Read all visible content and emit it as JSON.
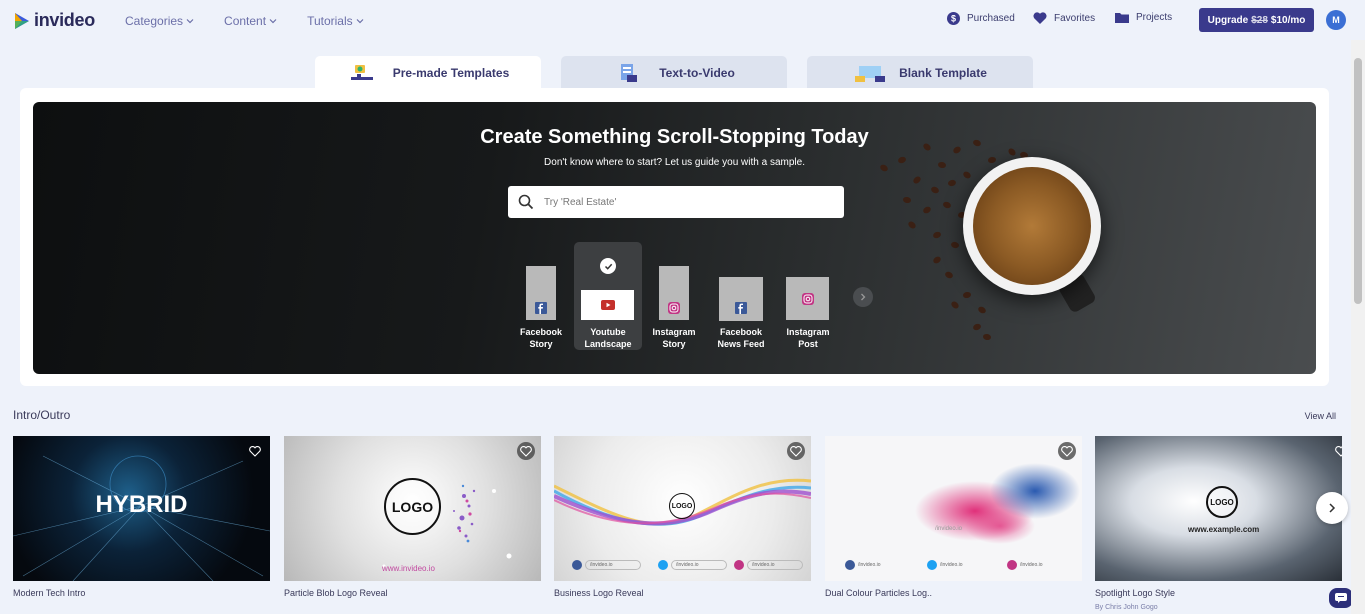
{
  "brand": {
    "name": "invideo"
  },
  "nav": {
    "menu": [
      {
        "label": "Categories"
      },
      {
        "label": "Content"
      },
      {
        "label": "Tutorials"
      }
    ],
    "purchased": "Purchased",
    "favorites": "Favorites",
    "projects": "Projects",
    "upgrade_prefix": "Upgrade",
    "upgrade_old_price": "$28",
    "upgrade_price": "$10/mo",
    "avatar_initial": "M"
  },
  "tabs": [
    {
      "label": "Pre-made Templates",
      "active": true
    },
    {
      "label": "Text-to-Video",
      "active": false
    },
    {
      "label": "Blank Template",
      "active": false
    }
  ],
  "hero": {
    "title": "Create Something Scroll-Stopping Today",
    "subtitle": "Don't know where to start? Let us guide you with a sample.",
    "search_placeholder": "Try 'Real Estate'",
    "formats": [
      {
        "line1": "Facebook",
        "line2": "Story",
        "icon": "facebook-icon"
      },
      {
        "line1": "Youtube",
        "line2": "Landscape",
        "icon": "youtube-icon",
        "selected": true
      },
      {
        "line1": "Instagram",
        "line2": "Story",
        "icon": "instagram-icon"
      },
      {
        "line1": "Facebook",
        "line2": "News Feed",
        "icon": "facebook-icon"
      },
      {
        "line1": "Instagram",
        "line2": "Post",
        "icon": "instagram-icon"
      }
    ]
  },
  "section": {
    "title": "Intro/Outro",
    "view_all": "View All",
    "cards": [
      {
        "title": "Modern Tech Intro",
        "image_text": "HYBRID"
      },
      {
        "title": "Particle Blob Logo Reveal",
        "image_text": "LOGO",
        "url": "www.invideo.io"
      },
      {
        "title": "Business Logo Reveal",
        "image_text": "LOGO",
        "socials": [
          "/invideo.io",
          "/invideo.io",
          "/invideo.io"
        ]
      },
      {
        "title": "Dual Colour Particles Log..",
        "url": "/invideo.io",
        "socials": [
          "/invideo.io",
          "/invideo.io",
          "/invideo.io"
        ]
      },
      {
        "title": "Spotlight Logo Style",
        "author": "By Chris John Gogo",
        "image_text": "LOGO",
        "url": "www.example.com"
      }
    ]
  },
  "colors": {
    "primary": "#3a3a8c",
    "nav_text": "#6b6fa8",
    "background": "#eef2fa",
    "avatar": "#3b6fd4"
  }
}
